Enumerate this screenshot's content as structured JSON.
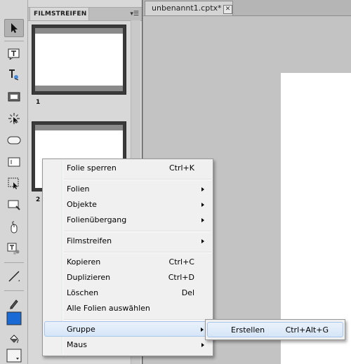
{
  "toolbar": {
    "tools": [
      {
        "icon": "selection-arrow-icon",
        "active": true
      },
      {
        "icon": "text-caption-icon"
      },
      {
        "icon": "text-animation-icon"
      },
      {
        "icon": "highlight-box-icon"
      },
      {
        "icon": "click-box-icon"
      },
      {
        "icon": "button-icon"
      },
      {
        "icon": "text-entry-box-icon"
      },
      {
        "icon": "rollover-area-icon"
      },
      {
        "icon": "zoom-area-icon"
      },
      {
        "icon": "mouse-icon"
      },
      {
        "icon": "widget-icon"
      },
      {
        "icon": "line-icon"
      },
      {
        "icon": "pencil-icon"
      },
      {
        "icon": "stroke-color-swatch-icon"
      },
      {
        "icon": "fill-bucket-icon"
      },
      {
        "icon": "fill-color-swatch-icon"
      }
    ],
    "stroke_color": "#1a6ad6"
  },
  "filmstrip": {
    "title": "FILMSTREIFEN",
    "menu_glyph": "▾☰",
    "slides": [
      {
        "number": "1"
      },
      {
        "number": "2"
      }
    ]
  },
  "document": {
    "tab_title": "unbenannt1.cptx*",
    "close_glyph": "✕"
  },
  "context_menu": {
    "items": [
      {
        "label": "Folie sperren",
        "shortcut": "Ctrl+K",
        "submenu": false
      },
      {
        "label": "Folien",
        "shortcut": "",
        "submenu": true
      },
      {
        "label": "Objekte",
        "shortcut": "",
        "submenu": true
      },
      {
        "label": "Folienübergang",
        "shortcut": "",
        "submenu": true
      },
      {
        "label": "Filmstreifen",
        "shortcut": "",
        "submenu": true
      },
      {
        "label": "Kopieren",
        "shortcut": "Ctrl+C",
        "submenu": false
      },
      {
        "label": "Duplizieren",
        "shortcut": "Ctrl+D",
        "submenu": false
      },
      {
        "label": "Löschen",
        "shortcut": "Del",
        "submenu": false
      },
      {
        "label": "Alle Folien auswählen",
        "shortcut": "",
        "submenu": false
      },
      {
        "label": "Gruppe",
        "shortcut": "",
        "submenu": true,
        "highlighted": true
      },
      {
        "label": "Maus",
        "shortcut": "",
        "submenu": true
      }
    ]
  },
  "submenu": {
    "items": [
      {
        "label": "Erstellen",
        "shortcut": "Ctrl+Alt+G",
        "highlighted": true
      }
    ]
  }
}
